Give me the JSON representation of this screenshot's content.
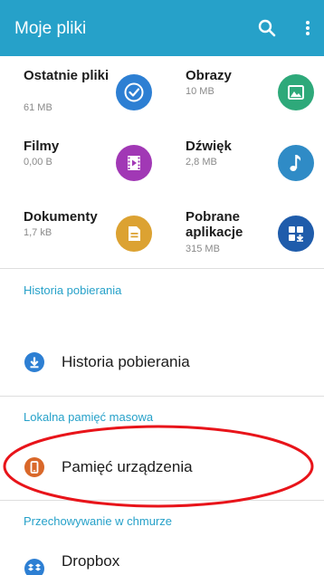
{
  "appbar": {
    "title": "Moje pliki",
    "search_icon": "search-icon",
    "more_icon": "more-vert-icon",
    "color": "#26a1c9"
  },
  "categories": [
    {
      "label": "Ostatnie pliki",
      "size": "61 MB",
      "icon": "clock-icon",
      "color": "#2d7fd3"
    },
    {
      "label": "Obrazy",
      "size": "10 MB",
      "icon": "image-icon",
      "color": "#2ea97a"
    },
    {
      "label": "Filmy",
      "size": "0,00 B",
      "icon": "video-icon",
      "color": "#a138b5"
    },
    {
      "label": "Dźwięk",
      "size": "2,8 MB",
      "icon": "music-note-icon",
      "color": "#2f8bc6"
    },
    {
      "label": "Dokumenty",
      "size": "1,7 kB",
      "icon": "document-icon",
      "color": "#dca232"
    },
    {
      "label": "Pobrane aplikacje",
      "size": "315 MB",
      "icon": "apps-download-icon",
      "color": "#1f5cab"
    }
  ],
  "sections": {
    "download_history": {
      "header": "Historia pobierania",
      "item": "Historia pobierania",
      "icon": "download-icon",
      "icon_color": "#2d7fd3"
    },
    "local_storage": {
      "header": "Lokalna pamięć masowa",
      "item": "Pamięć urządzenia",
      "icon": "phone-icon",
      "icon_color": "#d9682a"
    },
    "cloud": {
      "header": "Przechowywanie w chmurze",
      "item": "Dropbox",
      "icon": "dropbox-icon",
      "icon_color": "#2d7fd3"
    }
  },
  "annotation_color": "#e8141a"
}
